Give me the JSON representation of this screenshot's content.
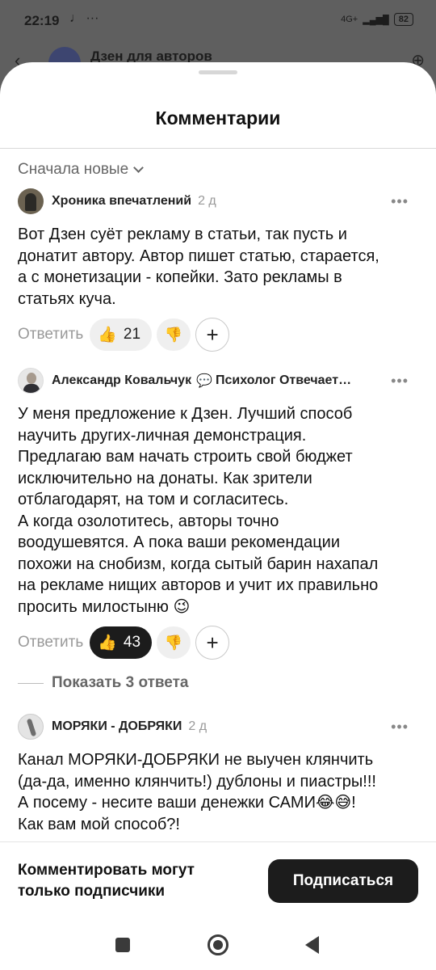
{
  "status_bar": {
    "time": "22:19",
    "left_icons": "♩ ···",
    "network": "4G+",
    "battery": "82"
  },
  "background_header": {
    "title": "Дзен для авторов",
    "back_icon": "arrow-left-icon"
  },
  "sheet": {
    "title": "Комментарии"
  },
  "sort": {
    "label": "Сначала новые",
    "icon": "chevron-down-icon"
  },
  "comments": [
    {
      "author": "Хроника впечатлений",
      "time": "2 д",
      "text": "Вот Дзен суёт рекламу в статьи, так пусть и\nдонатит автору. Автор пишет статью, старается,\nа с монетизации - копейки. Зато рекламы в\nстатьях куча.",
      "reply_label": "Ответить",
      "likes": "21",
      "liked": false
    },
    {
      "author": "Александр Ковальчук",
      "status": "Психолог Отвечает …",
      "text": "У меня предложение к Дзен. Лучший способ\nнаучить других-личная демонстрация.\nПредлагаю вам начать строить свой бюджет\nисключительно на донаты. Как зрители\nотблагодарят, на том и согласитесь.\nА когда озолотитесь, авторы точно\nвоодушевятся. А пока ваши рекомендации\nпохожи на снобизм, когда сытый барин нахапал\nна рекламе нищих авторов и учит их правильно\nпросить милостыню 😉",
      "reply_label": "Ответить",
      "likes": "43",
      "liked": true
    },
    {
      "author": "МОРЯКИ - ДОБРЯКИ",
      "time": "2 д",
      "text": "Канал МОРЯКИ-ДОБРЯКИ не выучен клянчить\n(да-да, именно клянчить!) дублоны и пиастры!!!\nА посему - несите ваши денежки САМИ😂😅!\nКак вам мой способ?!"
    }
  ],
  "show_replies": {
    "label": "Показать 3 ответа"
  },
  "footer": {
    "text": "Комментировать могут\nтолько подписчики",
    "subscribe_label": "Подписаться"
  },
  "icons": {
    "more": "•••",
    "like": "👍",
    "dislike": "👎",
    "plus": "+"
  }
}
